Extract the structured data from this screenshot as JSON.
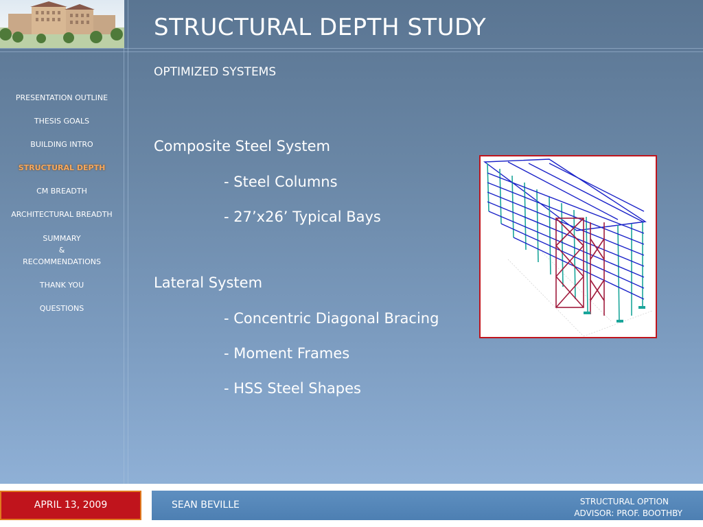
{
  "slide": {
    "title": "STRUCTURAL DEPTH STUDY",
    "subtitle": "OPTIMIZED SYSTEMS"
  },
  "nav": {
    "items": [
      {
        "label": "PRESENTATION OUTLINE"
      },
      {
        "label": "THESIS GOALS"
      },
      {
        "label": "BUILDING INTRO"
      },
      {
        "label": "STRUCTURAL DEPTH",
        "active": true
      },
      {
        "label": "CM BREADTH"
      },
      {
        "label": "ARCHITECTURAL BREADTH"
      },
      {
        "label": "SUMMARY"
      },
      {
        "label": "&"
      },
      {
        "label": "RECOMMENDATIONS"
      },
      {
        "label": "THANK YOU"
      },
      {
        "label": "QUESTIONS"
      }
    ],
    "active_color": "#f5a85e"
  },
  "content": {
    "composite_heading": "Composite Steel System",
    "composite_items": [
      "- Steel Columns",
      "- 27’x26’ Typical Bays"
    ],
    "lateral_heading": "Lateral System",
    "lateral_items": [
      "- Concentric Diagonal Bracing",
      "- Moment Frames",
      "- HSS Steel Shapes"
    ]
  },
  "footer": {
    "date": "APRIL 13, 2009",
    "name": "SEAN BEVILLE",
    "option": "STRUCTURAL OPTION",
    "advisor": "ADVISOR:  PROF. BOOTHBY"
  },
  "colors": {
    "accent_red": "#c0141c",
    "accent_orange": "#e07a1e",
    "footer_blue": "#4d7fb2",
    "model_columns": "#1aa59a",
    "model_beams": "#1a22c8",
    "model_braces": "#a01a3c"
  },
  "icons": {
    "header_image": "building-rendering-image",
    "model_image": "structural-steel-model-image"
  }
}
